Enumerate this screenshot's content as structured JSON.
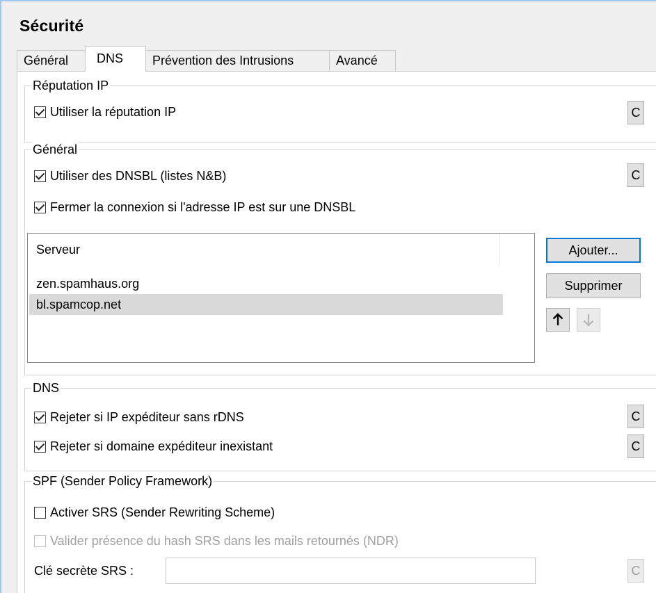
{
  "window": {
    "title": "Sécurité"
  },
  "tabs": [
    {
      "label": "Général",
      "active": false
    },
    {
      "label": "DNS",
      "active": true
    },
    {
      "label": "Prévention des Intrusions",
      "active": false
    },
    {
      "label": "Avancé",
      "active": false
    }
  ],
  "reputation": {
    "legend": "Réputation IP",
    "use_ip_reputation": {
      "label": "Utiliser la réputation IP",
      "checked": true
    },
    "c_button": "C"
  },
  "general": {
    "legend": "Général",
    "use_dnsbl": {
      "label": "Utiliser des DNSBL (listes N&B)",
      "checked": true
    },
    "close_connection": {
      "label": "Fermer la connexion si l'adresse IP est sur une DNSBL",
      "checked": true
    },
    "c_button": "C",
    "server_list": {
      "header": "Serveur",
      "rows": [
        "zen.spamhaus.org",
        "bl.spamcop.net"
      ],
      "selected_index": 1
    },
    "add_button": "Ajouter...",
    "delete_button": "Supprimer",
    "up_icon": "arrow-up-icon",
    "down_icon": "arrow-down-icon"
  },
  "dns": {
    "legend": "DNS",
    "reject_no_rdns": {
      "label": "Rejeter si IP expéditeur sans rDNS",
      "checked": true
    },
    "reject_nonexistent_domain": {
      "label": "Rejeter si domaine expéditeur inexistant",
      "checked": true
    },
    "c_button": "C"
  },
  "spf": {
    "legend": "SPF (Sender Policy Framework)",
    "enable_srs": {
      "label": "Activer SRS (Sender Rewriting Scheme)",
      "checked": false
    },
    "validate_srs_hash": {
      "label": "Valider présence du hash SRS dans les mails retournés (NDR)",
      "checked": false,
      "disabled": true
    },
    "secret_key_label": "Clé secrète SRS :",
    "secret_key_value": "",
    "c_button": "C"
  },
  "colors": {
    "accent": "#0078d7",
    "frame": "#9cc7ee",
    "selection": "#d9d9d9"
  }
}
